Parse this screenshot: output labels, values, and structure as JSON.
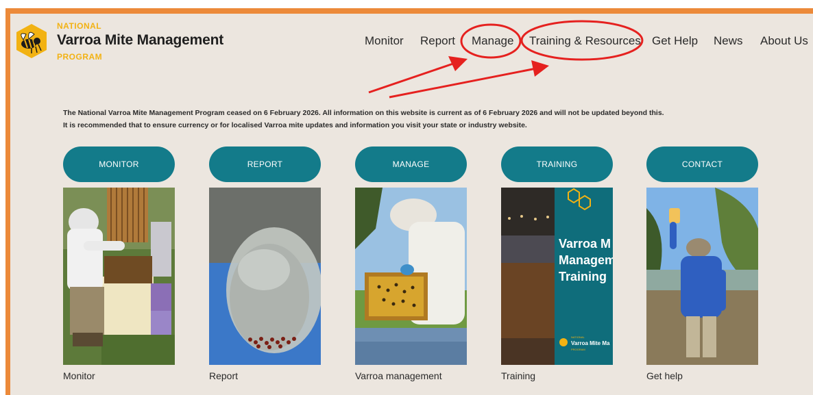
{
  "brand": {
    "top": "NATIONAL",
    "name": "Varroa Mite Management",
    "bottom": "PROGRAM"
  },
  "nav": [
    "Monitor",
    "Report",
    "Manage",
    "Training & Resources",
    "Get Help",
    "News",
    "About Us"
  ],
  "notice": {
    "line1": "The National Varroa Mite Management Program ceased on 6 February 2026. All information on this website is current as of 6 February 2026 and will not be updated beyond this.",
    "line2": "It is recommended that to ensure currency or for localised Varroa mite updates and information you visit your state or industry website."
  },
  "cards": [
    {
      "button": "MONITOR",
      "caption": "Monitor"
    },
    {
      "button": "REPORT",
      "caption": "Report"
    },
    {
      "button": "MANAGE",
      "caption": "Varroa management"
    },
    {
      "button": "TRAINING",
      "caption": "Training"
    },
    {
      "button": "CONTACT",
      "caption": "Get help"
    }
  ],
  "banner": {
    "line1": "Varroa M",
    "line2": "Managem",
    "line3": "Training",
    "logo_top": "NATIONAL",
    "logo_name": "Varroa Mite Ma",
    "logo_bottom": "PROGRAM"
  },
  "colors": {
    "accent": "#137b8a",
    "brand_yellow": "#f2b213",
    "frame_orange": "#ec8a3a",
    "annotation_red": "#e5211f",
    "background": "#ece6df"
  }
}
